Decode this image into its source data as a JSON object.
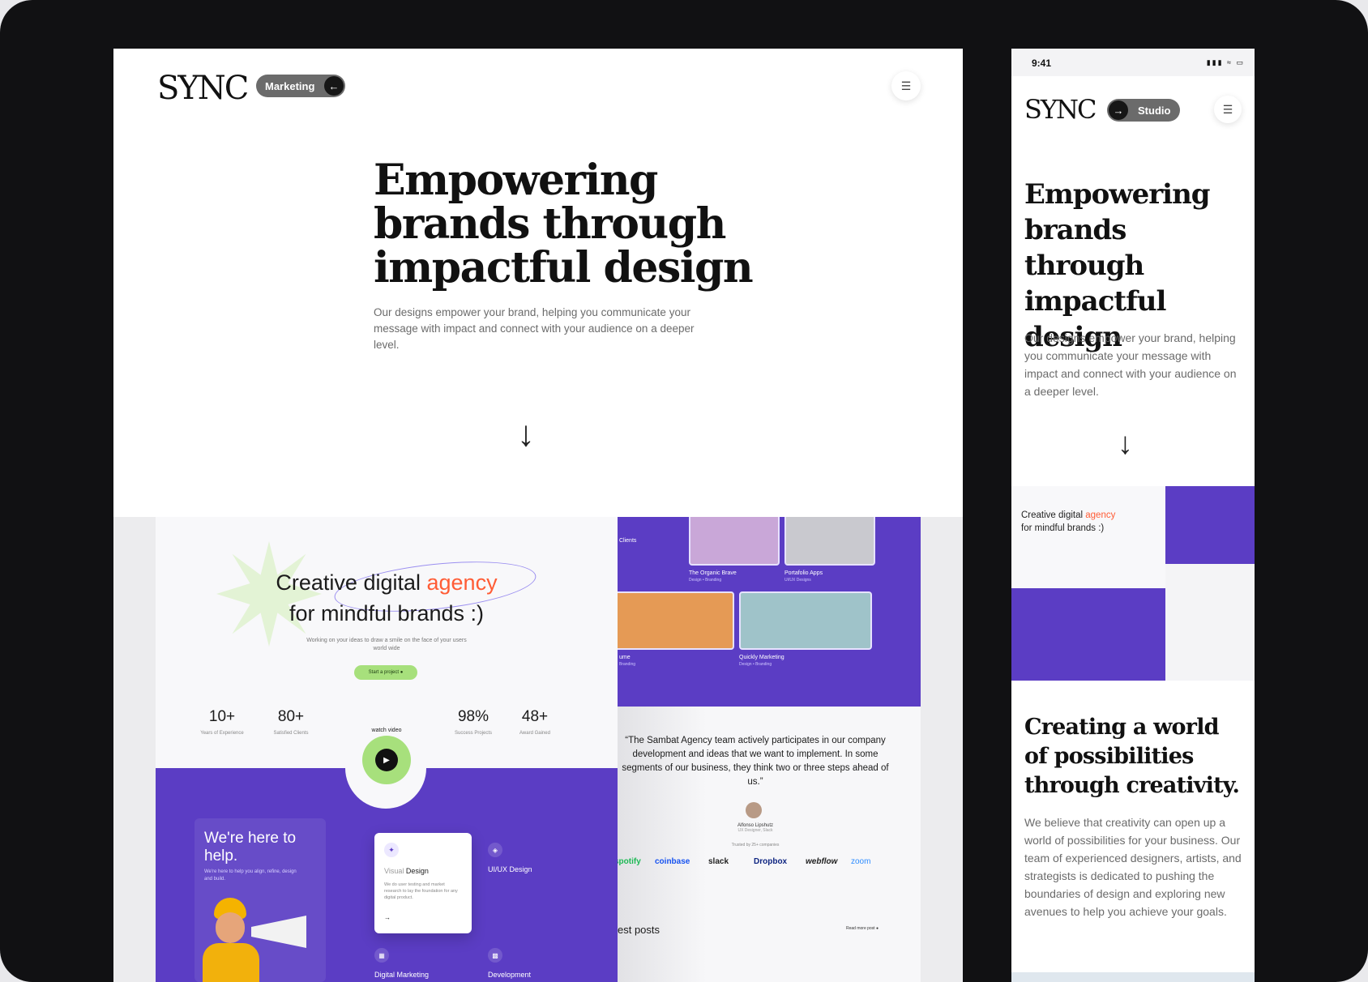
{
  "colors": {
    "accent_purple": "#5b3dc4",
    "accent_orange": "#ff5c35",
    "accent_green": "#a7e07c",
    "frame": "#111113"
  },
  "desktop": {
    "logo": "SYNC",
    "pill_label": "Marketing",
    "pill_icon": "arrow-left-icon",
    "menu_icon": "menu-icon",
    "hero_title": "Empowering brands through impactful design",
    "hero_sub": "Our designs empower your brand, helping you communicate your message with impact and connect with your audience on a deeper level.",
    "scroll_icon": "arrow-down-icon",
    "showcase_left": {
      "headline_pre": "Creative digital ",
      "headline_accent": "agency",
      "headline_post": "for mindful brands :)",
      "tagline": "Working on your ideas to draw a smile on the face of your users world wide",
      "cta": "Start a project",
      "stats": [
        {
          "n": "10+",
          "l": "Years of Experience"
        },
        {
          "n": "80+",
          "l": "Satisfied Clients"
        },
        {
          "n": "98%",
          "l": "Success Projects"
        },
        {
          "n": "48+",
          "l": "Award Gained"
        }
      ],
      "watch": "watch video",
      "help_title": "We're here to help.",
      "help_sub": "We're here to help you align, refine, design and build.",
      "card_title_light": "Visual",
      "card_title_bold": "Design",
      "card_sub": "We do user testing and market research to lay the foundation for any digital product.",
      "svc_1": "UI/UX Design",
      "svc_2": "Digital Marketing",
      "svc_3": "Development"
    },
    "showcase_right": {
      "thumbs": [
        {
          "t": "The Organic Brave",
          "s": "Design • Branding"
        },
        {
          "t": "Portafolio Apps",
          "s": "UI/UX Designs"
        },
        {
          "t": "ume",
          "s": "Branding"
        },
        {
          "t": "Quickly Marketing",
          "s": "Design • Branding"
        }
      ],
      "clients": "Clients",
      "quote": "“The Sambat Agency team actively participates in our company development and ideas that we want to implement. In some segments of our business, they think two or three steps ahead of us.”",
      "author": "Alfonso Lipshutz",
      "author_role": "UX Designer, Slack",
      "trusted": "Trusted by 25+ companies",
      "brands": [
        "spotify",
        "coinbase",
        "slack",
        "Dropbox",
        "webflow",
        "zoom"
      ],
      "posts": "est posts",
      "read_more": "Read more post"
    }
  },
  "mobile": {
    "time": "9:41",
    "logo": "SYNC",
    "pill_label": "Studio",
    "pill_icon": "arrow-right-icon",
    "hero_title": "Empowering brands through impactful design",
    "hero_sub": "Our designs empower your brand, helping you communicate your message with impact and connect with your audience on a deeper level.",
    "shot_headline_pre": "Creative digital ",
    "shot_headline_accent": "agency",
    "shot_headline_post": "for mindful brands :)",
    "section_title": "Creating a world of possibilities through creativity.",
    "section_body": "We believe that creativity can open up a world of possibilities for your business. Our team of experienced designers, artists, and strategists is dedicated to pushing the boundaries of design and exploring new avenues to help you achieve your goals."
  }
}
